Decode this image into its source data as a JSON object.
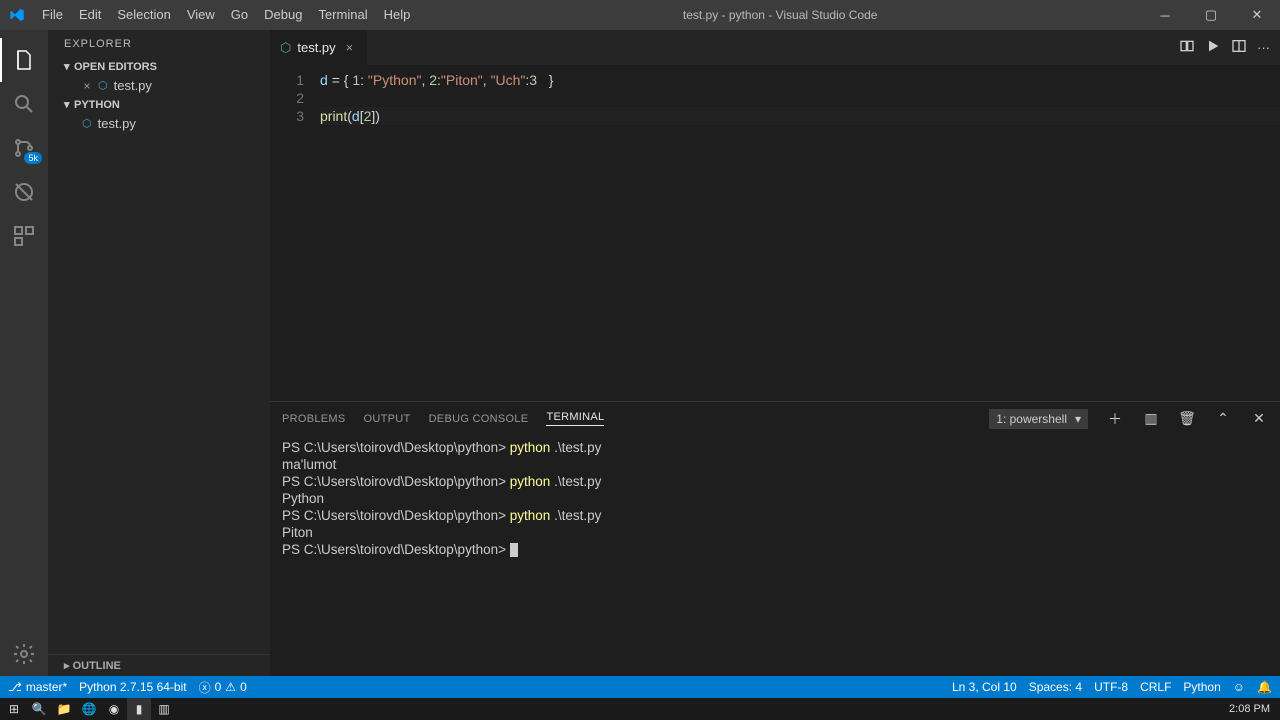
{
  "title": "test.py - python - Visual Studio Code",
  "menu": [
    "File",
    "Edit",
    "Selection",
    "View",
    "Go",
    "Debug",
    "Terminal",
    "Help"
  ],
  "sidebar": {
    "header": "EXPLORER",
    "open_editors": "OPEN EDITORS",
    "open_items": [
      {
        "name": "test.py"
      }
    ],
    "project": "PYTHON",
    "files": [
      {
        "name": "test.py"
      }
    ],
    "outline": "OUTLINE"
  },
  "tab": {
    "name": "test.py"
  },
  "code": {
    "lines": [
      {
        "n": "1",
        "html": "<span class='tk-id'>d</span> <span class='tk-op'>=</span> <span class='tk-br'>{</span> <span class='tk-num'>1</span><span class='tk-op'>:</span> <span class='tk-str'>\"Python\"</span><span class='tk-op'>,</span> <span class='tk-num'>2</span><span class='tk-op'>:</span><span class='tk-str'>\"Piton\"</span><span class='tk-op'>,</span> <span class='tk-str'>\"Uch\"</span><span class='tk-op'>:</span><span class='tk-num'>3</span>   <span class='tk-br'>}</span>"
      },
      {
        "n": "2",
        "html": ""
      },
      {
        "n": "3",
        "html": "<span class='tk-fn'>print</span><span class='tk-br'>(</span><span class='tk-id'>d</span><span class='tk-br'>[</span><span class='tk-num'>2</span><span class='tk-br'>]</span><span class='tk-br'>)</span>",
        "current": true
      }
    ]
  },
  "panel": {
    "tabs": [
      "PROBLEMS",
      "OUTPUT",
      "DEBUG CONSOLE",
      "TERMINAL"
    ],
    "active": 3,
    "terminal_selector": "1: powershell",
    "lines": [
      {
        "prompt": "PS C:\\Users\\toirovd\\Desktop\\python>",
        "cmd": "python",
        "arg": ".\\test.py"
      },
      {
        "out": "ma'lumot"
      },
      {
        "prompt": "PS C:\\Users\\toirovd\\Desktop\\python>",
        "cmd": "python",
        "arg": ".\\test.py"
      },
      {
        "out": "Python"
      },
      {
        "prompt": "PS C:\\Users\\toirovd\\Desktop\\python>",
        "cmd": "python",
        "arg": ".\\test.py"
      },
      {
        "out": "Piton"
      },
      {
        "prompt": "PS C:\\Users\\toirovd\\Desktop\\python>",
        "cursor": true
      }
    ]
  },
  "status": {
    "branch": "master*",
    "python": "Python 2.7.15 64-bit",
    "errors": "0",
    "warnings": "0",
    "ln": "Ln 3, Col 10",
    "spaces": "Spaces: 4",
    "enc": "UTF-8",
    "eol": "CRLF",
    "lang": "Python",
    "smile": "☺"
  },
  "activity_badge": "5k",
  "clock": "2:08 PM"
}
